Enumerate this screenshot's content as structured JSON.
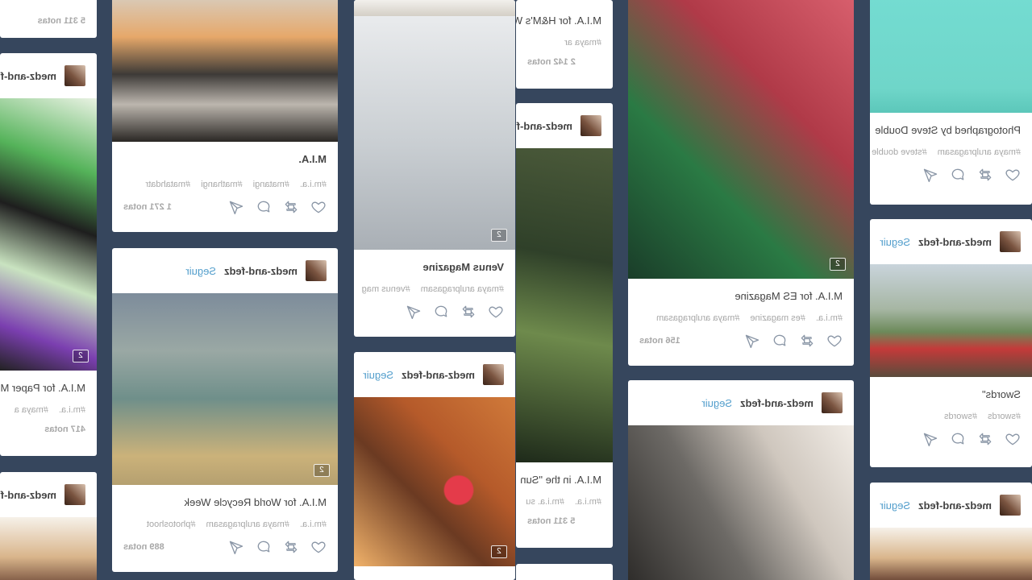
{
  "common": {
    "follow_label": "Seguir",
    "notes_suffix": "notas"
  },
  "col0": {
    "card0": {
      "notes": "5 311 notas"
    },
    "card1": {
      "username": "medz-and-fedz",
      "caption": "M.I.A. for Paper M",
      "tags": [
        "#m.i.a.",
        "#maya a"
      ],
      "notes": "417 notas",
      "photoset_count": "2"
    },
    "card2": {
      "username": "medz-and-fedz"
    }
  },
  "col1": {
    "card0": {
      "caption": "M.I.A.",
      "tags": [
        "#m.i.a.",
        "#matangi",
        "#mathangi",
        "#matahdatr"
      ],
      "notes": "1 271 notas"
    },
    "card1": {
      "username": "medz-and-fedz",
      "follow": "Seguir",
      "caption": "M.I.A. for World Recycle Week",
      "tags": [
        "#m.i.a.",
        "#maya arulpragasam",
        "#photoshoot"
      ],
      "notes": "889 notas",
      "photoset_count": "2"
    }
  },
  "col2": {
    "card0": {
      "caption": "Venus Magazine",
      "tags": [
        "#maya arulpragasam",
        "#venus mag"
      ],
      "photoset_count": "2"
    },
    "card1": {
      "username": "medz-and-fedz",
      "follow": "Seguir",
      "photoset_count": "2"
    }
  },
  "col3": {
    "card0": {
      "caption": "M.I.A. for H&M's W",
      "tags": [
        "#maya ar"
      ],
      "notes": "2 142 notas"
    },
    "card1": {
      "username": "medz-and-fedz",
      "caption": "M.I.A. in the \"Sun",
      "tags": [
        "#m.i.a.",
        "#m.i.a. su"
      ],
      "notes": "5 311 notas"
    }
  },
  "col4": {
    "card0": {
      "caption": "M.I.A. for ES Magazine",
      "tags": [
        "#m.i.a.",
        "#es magazine",
        "#maya arulpragasam"
      ],
      "notes": "156 notas",
      "photoset_count": "2"
    },
    "card1": {
      "username": "medz-and-fedz",
      "follow": "Seguir"
    }
  },
  "col5": {
    "card0": {
      "caption": "Photographed by Steve Double",
      "tags": [
        "#maya arulpragasam",
        "#steve double"
      ]
    },
    "card1": {
      "username": "medz-and-fedz",
      "follow": "Seguir",
      "caption": "Swords\"",
      "tags": [
        "#swords",
        "#swords"
      ]
    },
    "card2": {
      "username": "medz-and-fedz",
      "follow": "Seguir"
    }
  }
}
